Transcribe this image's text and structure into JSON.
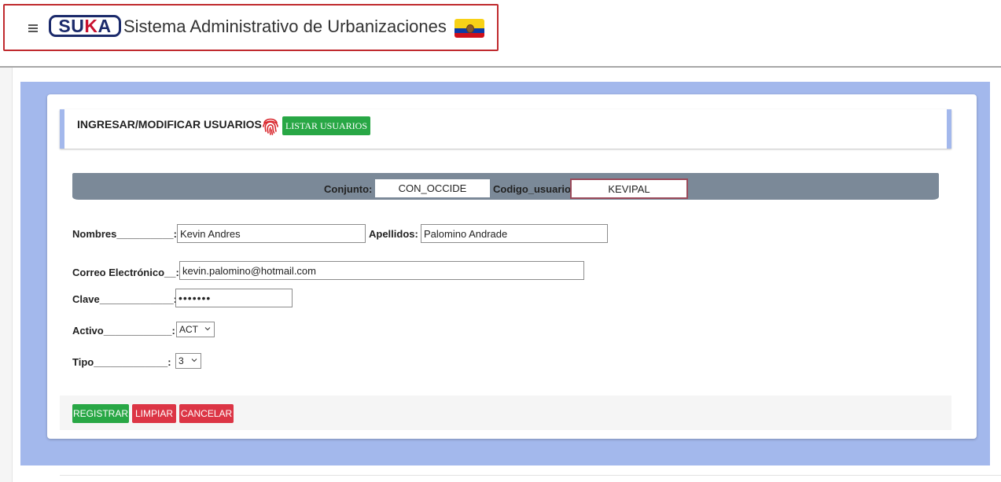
{
  "header": {
    "logo_s": "SU",
    "logo_k": "K",
    "logo_a": "A",
    "title": "Sistema Administrativo de Urbanizaciones",
    "flag_icon": "ecuador-flag-icon"
  },
  "card": {
    "title": "INGRESAR/MODIFICAR USUARIOS",
    "list_button": "LISTAR USUARIOS",
    "title_icon": "fingerprint-icon"
  },
  "key_bar": {
    "conjunto_label": "Conjunto:",
    "conjunto_value": "CON_OCCIDE",
    "codigo_label": "Codigo_usuario",
    "codigo_value": "KEVIPAL"
  },
  "form": {
    "nombres_label": "Nombres__________:",
    "nombres_value": "Kevin Andres",
    "apellidos_label": "Apellidos:",
    "apellidos_value": "Palomino Andrade",
    "correo_label": "Correo Electrónico__:",
    "correo_value": "kevin.palomino@hotmail.com",
    "clave_label": "Clave_____________:",
    "clave_value": "•••••••",
    "activo_label": "Activo____________:",
    "activo_value": "ACT",
    "tipo_label": "Tipo_____________:",
    "tipo_value": "3"
  },
  "actions": {
    "register": "REGISTRAR",
    "clear": "LIMPIAR",
    "cancel": "CANCELAR"
  },
  "colors": {
    "primary_green": "#28a745",
    "danger_red": "#dc3545",
    "frame_blue": "#a3b8ec",
    "key_bar_gray": "#7b8998",
    "brand_border_red": "#c02a2e"
  }
}
